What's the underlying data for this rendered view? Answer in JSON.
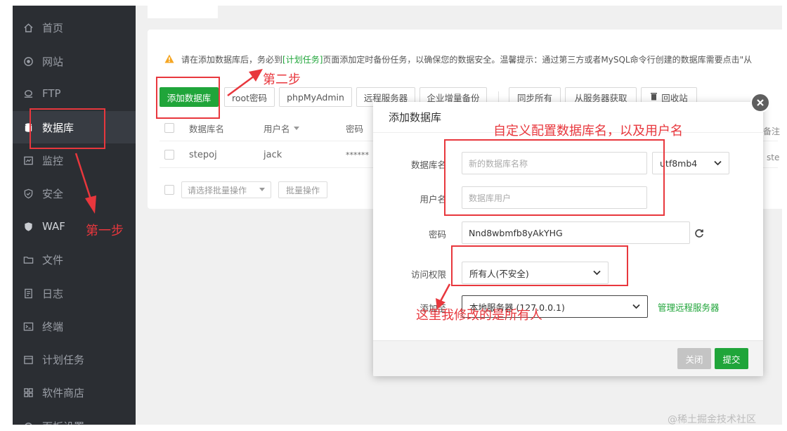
{
  "sidebar": {
    "items": [
      {
        "label": "首页",
        "icon": "home-icon"
      },
      {
        "label": "网站",
        "icon": "globe-icon"
      },
      {
        "label": "FTP",
        "icon": "ftp-icon"
      },
      {
        "label": "数据库",
        "icon": "database-icon"
      },
      {
        "label": "监控",
        "icon": "monitor-icon"
      },
      {
        "label": "安全",
        "icon": "shield-icon"
      },
      {
        "label": "WAF",
        "icon": "waf-shield-icon"
      },
      {
        "label": "文件",
        "icon": "folder-icon"
      },
      {
        "label": "日志",
        "icon": "log-icon"
      },
      {
        "label": "终端",
        "icon": "terminal-icon"
      },
      {
        "label": "计划任务",
        "icon": "calendar-icon"
      },
      {
        "label": "软件商店",
        "icon": "grid-icon"
      },
      {
        "label": "面板设置",
        "icon": "gear-icon"
      }
    ],
    "active_index": 3
  },
  "notice": {
    "prefix": "请在添加数据库后，务必到",
    "link": "[计划任务]",
    "suffix": "页面添加定时备份任务，以确保您的数据安全。温馨提示：通过第三方或者MySQL命令行创建的数据库需要点击\"从"
  },
  "toolbar": {
    "add_db": "添加数据库",
    "root_pwd": "root密码",
    "phpmyadmin": "phpMyAdmin",
    "remote_server": "远程服务器",
    "enterprise_backup": "企业增量备份",
    "sync_all": "同步所有",
    "fetch_from_server": "从服务器获取",
    "recycle_bin": "回收站"
  },
  "table": {
    "headers": {
      "name": "数据库名",
      "user": "用户名",
      "password": "密码",
      "remark": "备注"
    },
    "rows": [
      {
        "name": "stepoj",
        "user": "jack",
        "password": "******",
        "remark": "ste"
      }
    ]
  },
  "batch": {
    "select_placeholder": "请选择批量操作",
    "button": "批量操作"
  },
  "dialog": {
    "title": "添加数据库",
    "db_name_label": "数据库名",
    "db_name_placeholder": "新的数据库名称",
    "charset": "utf8mb4",
    "username_label": "用户名",
    "username_placeholder": "数据库用户",
    "password_label": "密码",
    "password_value": "Nnd8wbmfb8yAkYHG",
    "access_label": "访问权限",
    "access_value": "所有人(不安全)",
    "add_to_label": "添加至",
    "add_to_value": "本地服务器 (127.0.0.1)",
    "manage_remote_link": "管理远程服务器",
    "close_button": "关闭",
    "submit_button": "提交"
  },
  "annotations": {
    "step1": "第一步",
    "step2": "第二步",
    "config_note": "自定义配置数据库名，以及用户名",
    "access_note": "这里我修改的是所有人"
  },
  "watermark": "@稀土掘金技术社区",
  "colors": {
    "primary": "#20a53a",
    "sidebar_bg": "#2b2e33",
    "annotation": "#e8373d",
    "warning": "#f5a623"
  }
}
